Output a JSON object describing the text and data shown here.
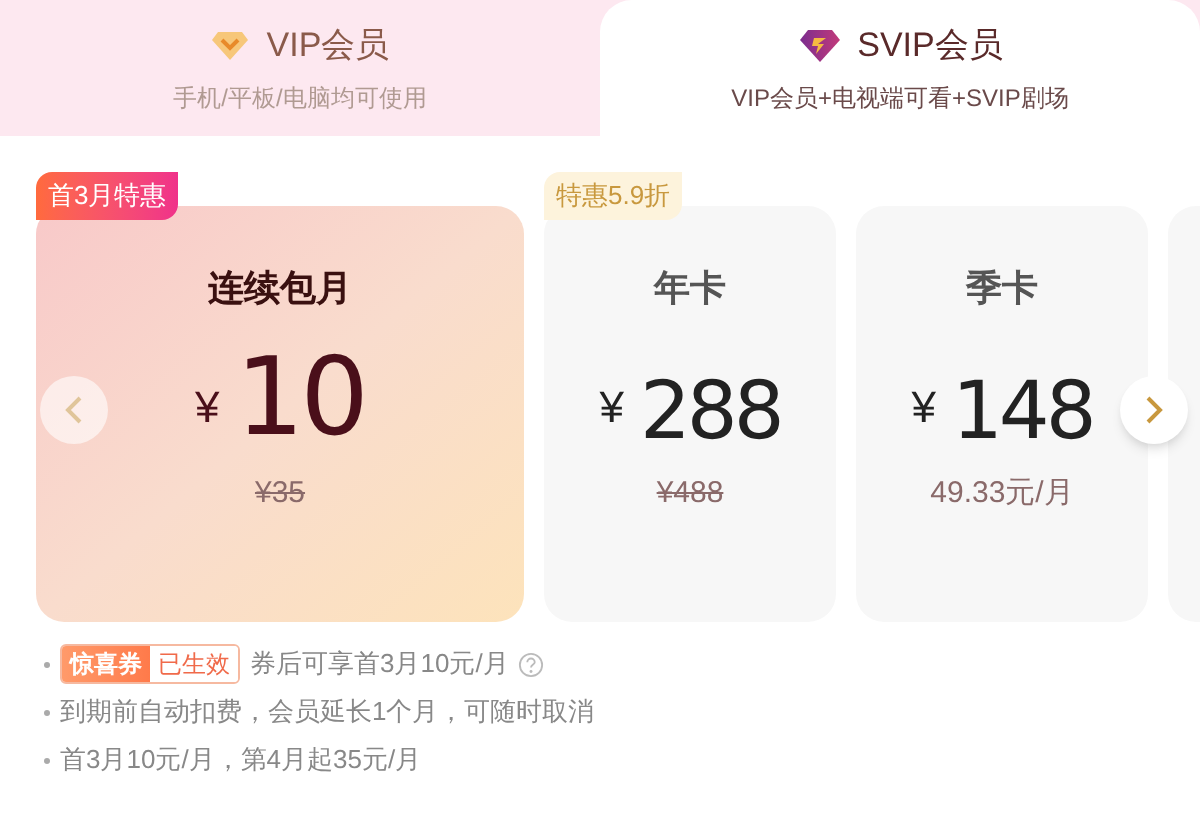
{
  "tabs": [
    {
      "title": "VIP会员",
      "subtitle": "手机/平板/电脑均可使用",
      "selected": false
    },
    {
      "title": "SVIP会员",
      "subtitle": "VIP会员+电视端可看+SVIP剧场",
      "selected": true
    }
  ],
  "plans": [
    {
      "badge": {
        "kind": "hot",
        "text": "首3月特惠"
      },
      "name": "连续包月",
      "currency": "¥",
      "price": "10",
      "sub": {
        "kind": "original",
        "text": "¥35"
      },
      "selected": true
    },
    {
      "badge": {
        "kind": "discount",
        "text": "特惠5.9折"
      },
      "name": "年卡",
      "currency": "¥",
      "price": "288",
      "sub": {
        "kind": "original",
        "text": "¥488"
      },
      "selected": false
    },
    {
      "name": "季卡",
      "currency": "¥",
      "price": "148",
      "sub": {
        "kind": "note",
        "text": "49.33元/月"
      },
      "selected": false
    }
  ],
  "notes": [
    {
      "coupon": {
        "name": "惊喜券",
        "status": "已生效"
      },
      "text": "券后可享首3月10元/月",
      "help": true
    },
    {
      "text": "到期前自动扣费，会员延长1个月，可随时取消",
      "help": false
    },
    {
      "text": "首3月10元/月，第4月起35元/月",
      "help": false
    }
  ]
}
